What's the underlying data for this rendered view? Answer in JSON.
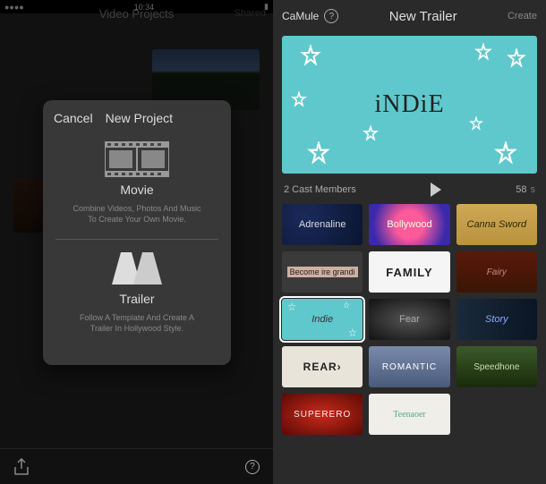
{
  "statusbar": {
    "time": "10:34"
  },
  "leftPane": {
    "header": {
      "title": "Video Projects",
      "side": "Shared"
    },
    "dialog": {
      "cancel": "Cancel",
      "title": "New Project",
      "movie": {
        "label": "Movie",
        "desc1": "Combine Videos, Photos And Music",
        "desc2": "To Create Your Own Movie."
      },
      "trailer": {
        "label": "Trailer",
        "desc1": "Follow A Template And Create A",
        "desc2": "Trailer In Hollywood Style."
      }
    }
  },
  "rightPane": {
    "header": {
      "back": "CaMule",
      "title": "New Trailer",
      "action": "Create"
    },
    "preview": {
      "title": "iNDiE",
      "cast": "2 Cast Members",
      "duration": "58",
      "durUnit": "s"
    },
    "templates": [
      {
        "id": "adrenaline",
        "label": "Adrenaline"
      },
      {
        "id": "bollywood",
        "label": "Bollywood"
      },
      {
        "id": "canna",
        "label": "Canna Sword"
      },
      {
        "id": "become",
        "label": "Become ire grandi"
      },
      {
        "id": "family",
        "label": "FAMILY"
      },
      {
        "id": "fairy",
        "label": "Fairy"
      },
      {
        "id": "indie",
        "label": "Indie",
        "selected": true
      },
      {
        "id": "fear",
        "label": "Fear"
      },
      {
        "id": "story",
        "label": "Story"
      },
      {
        "id": "rear",
        "label": "REAR›"
      },
      {
        "id": "romantic",
        "label": "ROMANTIC"
      },
      {
        "id": "speedhone",
        "label": "Speedhone"
      },
      {
        "id": "superhero",
        "label": "SUPERERO"
      },
      {
        "id": "teenager",
        "label": "Teenaoer"
      }
    ]
  }
}
